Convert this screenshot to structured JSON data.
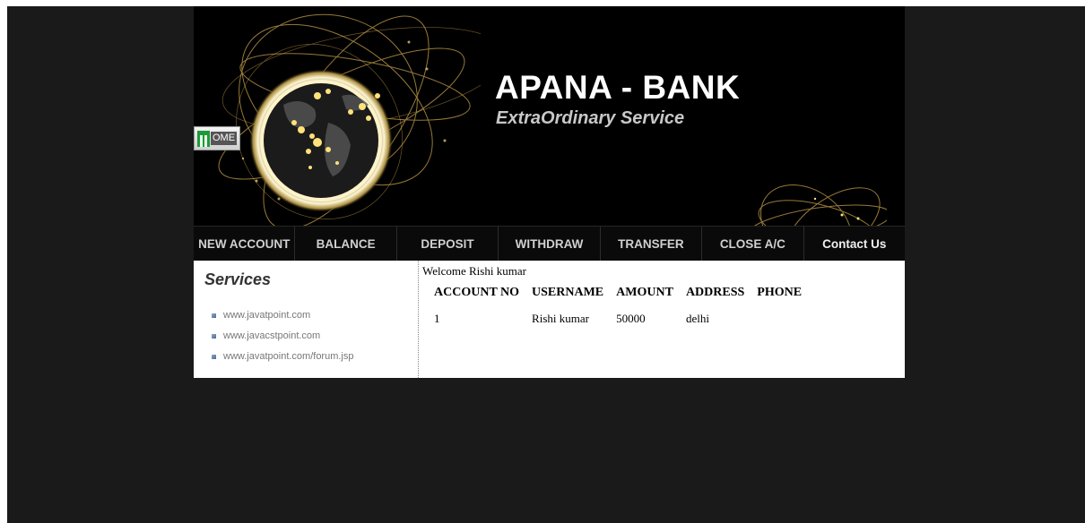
{
  "header": {
    "title": "APANA - BANK",
    "tagline": "ExtraOrdinary Service",
    "home_button": "OME"
  },
  "nav": {
    "items": [
      "NEW ACCOUNT",
      "BALANCE",
      "DEPOSIT",
      "WITHDRAW",
      "TRANSFER",
      "CLOSE A/C",
      "Contact Us"
    ]
  },
  "sidebar": {
    "title": "Services",
    "links": [
      "www.javatpoint.com",
      "www.javacstpoint.com",
      "www.javatpoint.com/forum.jsp"
    ]
  },
  "main": {
    "welcome": "Welcome Rishi kumar",
    "table": {
      "headers": [
        "ACCOUNT NO",
        "USERNAME",
        "AMOUNT",
        "ADDRESS",
        "PHONE"
      ],
      "rows": [
        [
          "1",
          "Rishi kumar",
          "50000",
          "delhi",
          ""
        ]
      ]
    }
  },
  "colors": {
    "page_background": "#1a1a1a",
    "header_background": "#000000",
    "nav_text": "#d0d0d0",
    "globe_glow": "#ffd84a"
  },
  "icons": [
    "home-icon",
    "globe-graphic",
    "bullet-icon"
  ]
}
